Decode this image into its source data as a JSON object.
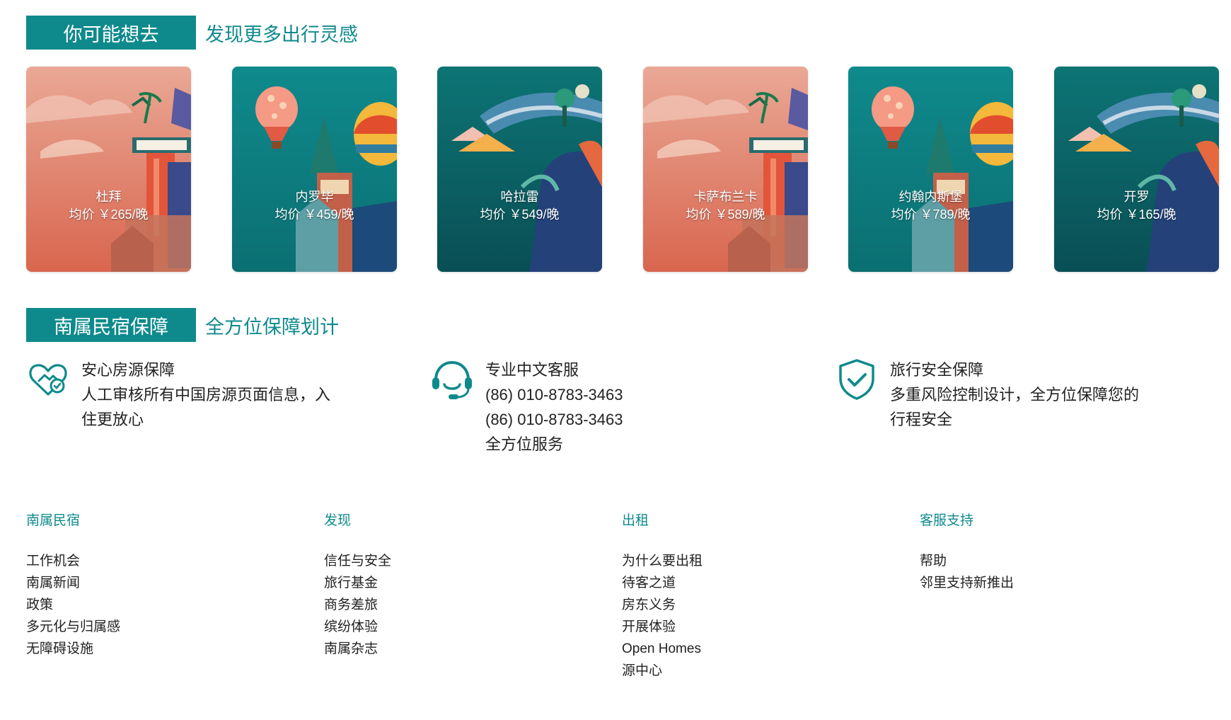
{
  "section1": {
    "badge": "你可能想去",
    "subtitle": "发现更多出行灵感"
  },
  "cards": [
    {
      "city": "杜拜",
      "price": "均价 ￥265/晚",
      "theme": "peach"
    },
    {
      "city": "内罗毕",
      "price": "均价 ￥459/晚",
      "theme": "teal"
    },
    {
      "city": "哈拉雷",
      "price": "均价 ￥549/晚",
      "theme": "deep"
    },
    {
      "city": "卡萨布兰卡",
      "price": "均价 ￥589/晚",
      "theme": "peach"
    },
    {
      "city": "约翰内斯堡",
      "price": "均价 ￥789/晚",
      "theme": "teal"
    },
    {
      "city": "开罗",
      "price": "均价 ￥165/晚",
      "theme": "deep"
    }
  ],
  "section2": {
    "badge": "南属民宿保障",
    "subtitle": "全方位保障划计"
  },
  "guarantees": [
    {
      "icon": "heart-handshake-icon",
      "title": "安心房源保障",
      "lines": [
        "人工审核所有中国房源页面信息，入",
        "住更放心"
      ]
    },
    {
      "icon": "headset-icon",
      "title": "专业中文客服",
      "lines": [
        "(86) 010-8783-3463",
        "(86) 010-8783-3463",
        "全方位服务"
      ]
    },
    {
      "icon": "shield-check-icon",
      "title": "旅行安全保障",
      "lines": [
        "多重风险控制设计，全方位保障您的",
        "行程安全"
      ]
    }
  ],
  "footer": [
    {
      "title": "南属民宿",
      "links": [
        "工作机会",
        "南属新闻",
        "政策",
        "多元化与归属感",
        "无障碍设施"
      ]
    },
    {
      "title": "发现",
      "links": [
        "信任与安全",
        "旅行基金",
        "商务差旅",
        "缤纷体验",
        "南属杂志"
      ]
    },
    {
      "title": "出租",
      "links": [
        "为什么要出租",
        "待客之道",
        "房东义务",
        "开展体验",
        "Open Homes",
        "源中心"
      ]
    },
    {
      "title": "客服支持",
      "links": [
        "帮助",
        "邻里支持新推出"
      ]
    }
  ],
  "colors": {
    "accent": "#0f8a8c",
    "peach": "#e7a890",
    "teal": "#0f8a8c",
    "deep": "#0b6e6a"
  }
}
